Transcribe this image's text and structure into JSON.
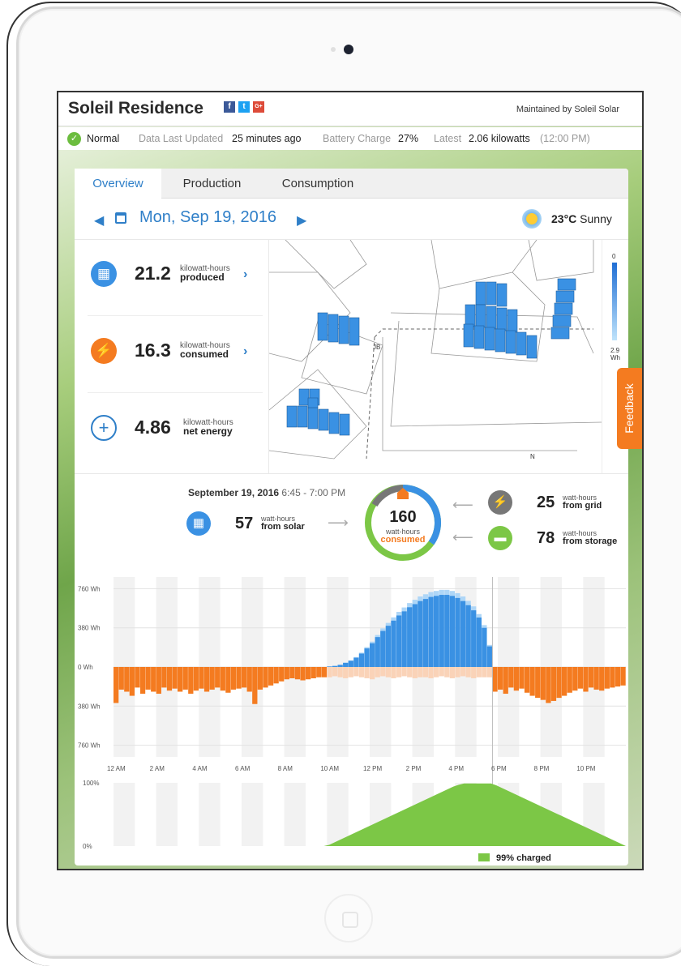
{
  "header": {
    "title": "Soleil Residence",
    "maintained": "Maintained by Soleil Solar",
    "social": [
      "f",
      "t",
      "G+"
    ]
  },
  "status": {
    "state": "Normal",
    "updated_label": "Data Last Updated",
    "updated_value": "25 minutes ago",
    "battery_label": "Battery Charge",
    "battery_value": "27%",
    "latest_label": "Latest",
    "latest_value": "2.06 kilowatts",
    "latest_time": "(12:00 PM)"
  },
  "tabs": [
    "Overview",
    "Production",
    "Consumption"
  ],
  "date": "Mon, Sep 19, 2016",
  "weather": {
    "temp": "23°C",
    "cond": "Sunny"
  },
  "stats": [
    {
      "value": "21.2",
      "unit": "kilowatt-hours",
      "label": "produced"
    },
    {
      "value": "16.3",
      "unit": "kilowatt-hours",
      "label": "consumed"
    },
    {
      "value": "4.86",
      "unit": "kilowatt-hours",
      "label": "net energy"
    }
  ],
  "map_legend": {
    "top": "0",
    "bottom": "2.9",
    "unit": "Wh"
  },
  "map_labels": {
    "jb": "JB",
    "north": "N"
  },
  "feedback": "Feedback",
  "flow": {
    "date": "September 19, 2016",
    "time": "6:45 - 7:00 PM",
    "solar": {
      "value": "57",
      "unit": "watt-hours",
      "label": "from solar"
    },
    "center": {
      "value": "160",
      "unit": "watt-hours",
      "label": "consumed"
    },
    "grid": {
      "value": "25",
      "unit": "watt-hours",
      "label": "from grid"
    },
    "storage": {
      "value": "78",
      "unit": "watt-hours",
      "label": "from storage"
    }
  },
  "chart_data": [
    {
      "type": "bar",
      "ylabels": [
        "760 Wh",
        "380 Wh",
        "0 Wh",
        "380 Wh",
        "760 Wh"
      ],
      "xlabels": [
        "12 AM",
        "2 AM",
        "4 AM",
        "6 AM",
        "8 AM",
        "10 AM",
        "12 PM",
        "2 PM",
        "4 PM",
        "6 PM",
        "8 PM",
        "10 PM"
      ],
      "series": [
        {
          "values": [
            0,
            0,
            0,
            0,
            0,
            0,
            0,
            0,
            0,
            0,
            0,
            0,
            0,
            0,
            0,
            0,
            0,
            0,
            0,
            0,
            0,
            0,
            0,
            0,
            0,
            0,
            0,
            0,
            0,
            0,
            0,
            0,
            0,
            0,
            0,
            0,
            0,
            0,
            0,
            0,
            5,
            10,
            20,
            40,
            60,
            90,
            130,
            180,
            230,
            290,
            350,
            400,
            450,
            500,
            540,
            580,
            610,
            640,
            660,
            680,
            690,
            700,
            700,
            690,
            670,
            640,
            600,
            550,
            480,
            380,
            200,
            0,
            0,
            0,
            0,
            0,
            0,
            0,
            0,
            0,
            0,
            0,
            0,
            0,
            0,
            0,
            0,
            0,
            0,
            0,
            0,
            0,
            0,
            0,
            0,
            0
          ]
        },
        {
          "values": [
            0,
            0,
            0,
            0,
            0,
            0,
            0,
            0,
            0,
            0,
            0,
            0,
            0,
            0,
            0,
            0,
            0,
            0,
            0,
            0,
            0,
            0,
            0,
            0,
            0,
            0,
            0,
            0,
            0,
            0,
            0,
            0,
            0,
            0,
            0,
            0,
            0,
            0,
            0,
            0,
            0,
            0,
            0,
            0,
            0,
            0,
            0,
            0,
            0,
            0,
            0,
            0,
            0,
            0,
            0,
            0,
            0,
            0,
            0,
            0,
            0,
            0,
            0,
            0,
            0,
            0,
            0,
            0,
            0,
            0,
            0,
            0,
            0,
            0,
            0,
            0,
            0,
            0,
            0,
            0,
            0,
            0,
            0,
            0,
            0,
            0,
            0,
            0,
            0,
            0,
            0,
            0,
            0,
            0,
            0,
            0
          ]
        },
        {
          "values": [
            -350,
            -220,
            -240,
            -280,
            -200,
            -260,
            -220,
            -240,
            -260,
            -200,
            -230,
            -210,
            -240,
            -220,
            -260,
            -230,
            -210,
            -240,
            -220,
            -200,
            -230,
            -250,
            -220,
            -210,
            -200,
            -240,
            -360,
            -220,
            -200,
            -180,
            -160,
            -140,
            -120,
            -110,
            -120,
            -130,
            -120,
            -110,
            -100,
            -100,
            -100,
            -90,
            -100,
            -110,
            -100,
            -90,
            -100,
            -110,
            -120,
            -100,
            -90,
            -100,
            -110,
            -100,
            -90,
            -100,
            -110,
            -100,
            -100,
            -110,
            -100,
            -90,
            -100,
            -110,
            -100,
            -90,
            -100,
            -110,
            -100,
            -100,
            -100,
            -240,
            -220,
            -260,
            -200,
            -230,
            -210,
            -250,
            -280,
            -300,
            -320,
            -350,
            -330,
            -300,
            -280,
            -250,
            -230,
            -210,
            -240,
            -200,
            -220,
            -230,
            -210,
            -200,
            -190,
            -180
          ]
        }
      ],
      "ylim": [
        -760,
        760
      ]
    },
    {
      "type": "area",
      "ylabels": [
        "100%",
        "0%"
      ],
      "values": [
        0,
        0,
        0,
        0,
        0,
        0,
        0,
        0,
        0,
        0,
        0,
        0,
        0,
        0,
        0,
        0,
        0,
        0,
        0,
        0,
        0,
        0,
        0,
        0,
        0,
        0,
        0,
        0,
        0,
        0,
        0,
        0,
        0,
        0,
        0,
        0,
        0,
        0,
        0,
        0,
        2,
        6,
        10,
        14,
        18,
        22,
        26,
        30,
        34,
        38,
        42,
        46,
        50,
        54,
        58,
        62,
        66,
        70,
        74,
        78,
        82,
        86,
        90,
        94,
        97,
        99,
        99,
        99,
        99,
        99,
        99,
        96,
        92,
        88,
        84,
        80,
        76,
        72,
        68,
        64,
        60,
        56,
        52,
        48,
        44,
        40,
        36,
        32,
        28,
        24,
        20,
        16,
        12,
        8,
        4,
        0
      ],
      "label": "99% charged",
      "ylim": [
        0,
        100
      ]
    }
  ],
  "colors": {
    "solar": "#3a91e3",
    "solar_light": "#aed6f7",
    "consumption": "#f47b20",
    "consumption_light": "#fad3b8",
    "storage": "#7cc746",
    "grid": "#777777"
  }
}
